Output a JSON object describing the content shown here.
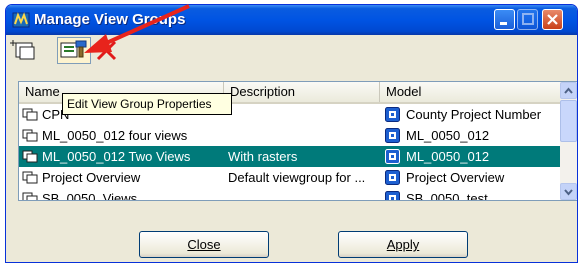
{
  "window": {
    "title": "Manage View Groups",
    "controls": [
      "minimize-icon",
      "maximize-icon",
      "close-icon"
    ]
  },
  "toolbar": {
    "buttons": [
      {
        "name": "new-view-group",
        "icon": "folder-new-icon"
      },
      {
        "name": "edit-view-group-properties",
        "icon": "edit-properties-icon"
      },
      {
        "name": "delete-view-group",
        "icon": "delete-x-icon"
      }
    ],
    "tooltip": "Edit View Group Properties"
  },
  "list": {
    "headers": {
      "name": "Name",
      "description": "Description",
      "model": "Model"
    },
    "rows": [
      {
        "name": "CPN",
        "description": "",
        "model": "County Project Number",
        "selected": false
      },
      {
        "name": "ML_0050_012 four views",
        "description": "",
        "model": "ML_0050_012",
        "selected": false
      },
      {
        "name": "ML_0050_012 Two Views",
        "description": "With rasters",
        "model": "ML_0050_012",
        "selected": true
      },
      {
        "name": "Project Overview",
        "description": "Default viewgroup for ...",
        "model": "Project Overview",
        "selected": false
      },
      {
        "name": "SB_0050_Views",
        "description": "",
        "model": "SB_0050_test",
        "selected": false
      }
    ]
  },
  "buttons": {
    "close": "Close",
    "apply": "Apply"
  },
  "colors": {
    "selected_row": "#007a7a",
    "title_bar": "#0054e3",
    "arrow": "#e8241c"
  }
}
